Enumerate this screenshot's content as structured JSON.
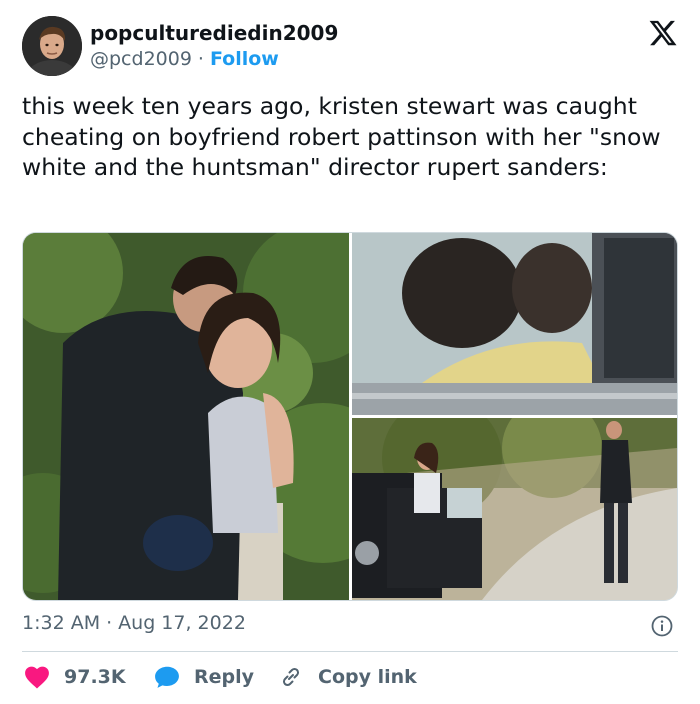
{
  "author": {
    "display_name": "popculturediedin2009",
    "handle": "@pcd2009",
    "separator": "·",
    "follow_label": "Follow",
    "avatar_icon": "person-avatar"
  },
  "brand": {
    "logo_icon": "x-logo"
  },
  "tweet": {
    "text": "this week ten years ago, kristen stewart was caught cheating on boyfriend robert pattinson with her \"snow white and the huntsman\" director rupert sanders:"
  },
  "media": {
    "photo_count": 3,
    "photos": [
      {
        "subject": "couple hugging outdoors among greenery"
      },
      {
        "subject": "couple kissing seen through car window"
      },
      {
        "subject": "woman by open car door, man standing on dirt road"
      }
    ]
  },
  "meta": {
    "time": "1:32 AM",
    "separator": "·",
    "date": "Aug 17, 2022"
  },
  "actions": {
    "likes": "97.3K",
    "reply_label": "Reply",
    "copy_link_label": "Copy link"
  },
  "colors": {
    "like": "#f91880",
    "reply": "#1d9bf0",
    "link": "#1d9bf0",
    "text": "#0f1419",
    "secondary": "#536471",
    "border": "#cfd9de"
  }
}
